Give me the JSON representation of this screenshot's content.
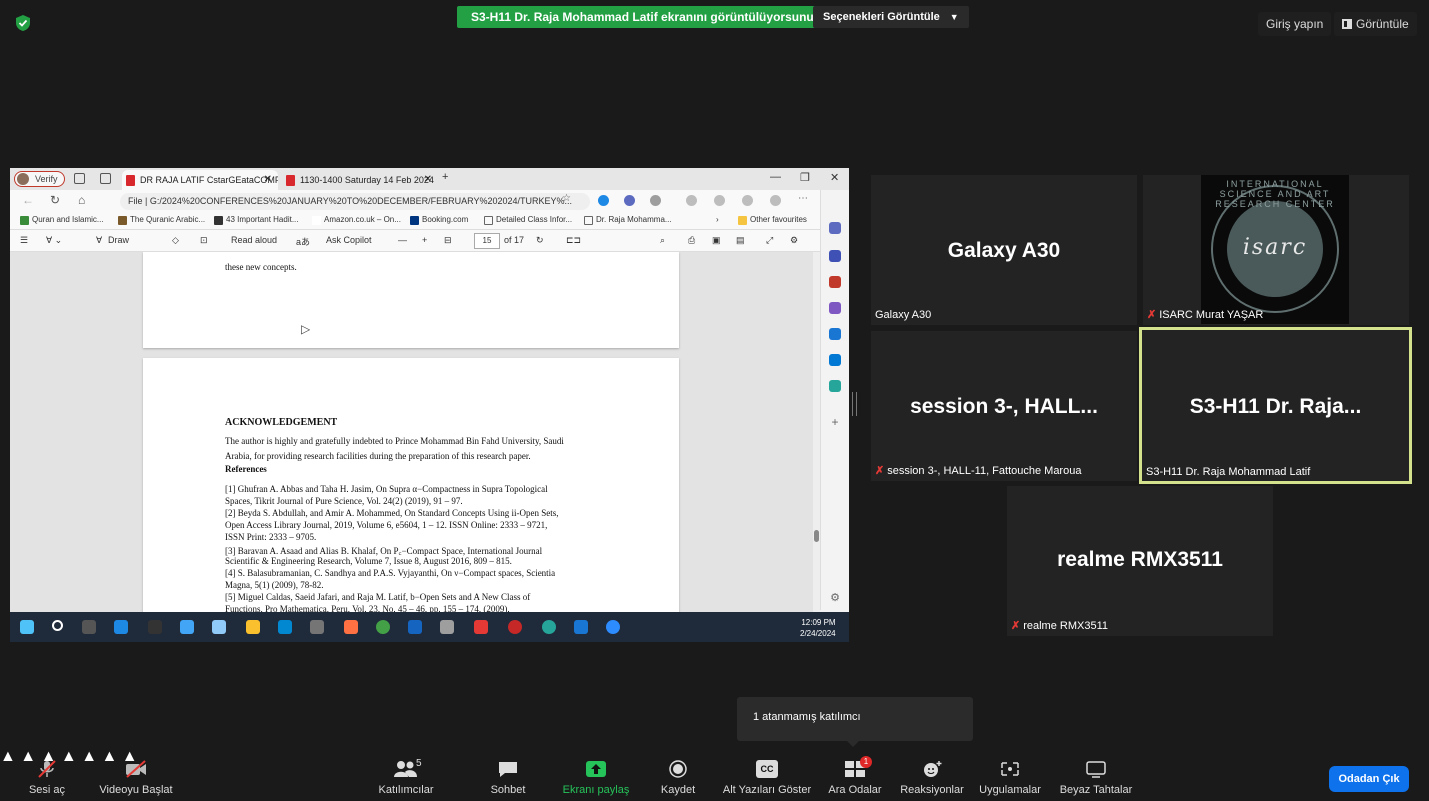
{
  "top": {
    "share_banner": "S3-H11 Dr. Raja Mohammad Latif ekranını görüntülüyorsunuz",
    "view_options": "Seçenekleri Görüntüle",
    "signin": "Giriş yapın",
    "view": "Görüntüle"
  },
  "browser": {
    "verify_label": "Verify",
    "tabs": [
      {
        "label": "DR RAJA LATIF CstarGEataCOMF"
      },
      {
        "label": "1130-1400 Saturday 14 Feb 2024"
      }
    ],
    "url": "File | G:/2024%20CONFERENCES%20JANUARY%20TO%20DECEMBER/FEBRUARY%202024/TURKEY%...",
    "favourites": [
      "Quran and Islamic...",
      "The Quranic Arabic...",
      "43 Important Hadit...",
      "Amazon.co.uk – On...",
      "Booking.com",
      "Detailed Class Infor...",
      "Dr. Raja Mohamma...",
      "Other favourites"
    ],
    "pdf_toolbar": {
      "draw": "Draw",
      "read_aloud": "Read aloud",
      "ask_copilot": "Ask Copilot",
      "page": "15",
      "of_pages": "of 17"
    },
    "page1_text": "these new concepts.",
    "page2": {
      "heading": "ACKNOWLEDGEMENT",
      "ack_line1": "The author is highly and gratefully indebted to Prince Mohammad Bin Fahd University, Saudi",
      "ack_line2": "Arabia, for providing research facilities during the preparation of this research paper.",
      "references": "References",
      "refs": [
        "[1]  Ghufran A. Abbas and Taha H. Jasim, On Supra α−Compactness in Supra Topological",
        "       Spaces, Tikrit Journal of Pure Science, Vol. 24(2) (2019), 91 – 97.",
        "[2]  Beyda S. Abdullah, and Amir A. Mohammed, On Standard Concepts Using ii-Open Sets,",
        "       Open Access Library Journal, 2019, Volume 6, e5604, 1 – 12. ISSN Online: 2333 – 9721,",
        "       ISSN Print: 2333 – 9705.",
        "[3]  Baravan A. Asaad and Alias B. Khalaf, On P꜀−Compact Space, International Journal",
        "       Scientific & Engineering Research, Volume 7, Issue 8, August 2016, 809 – 815.",
        "[4]  S. Balasubramanian, C. Sandhya and P.A.S. Vyjayanthi, On ν−Compact spaces, Scientia",
        "       Magna, 5(1) (2009), 78-82.",
        "[5]  Miguel Caldas, Saeid Jafari, and Raja M. Latif, b−Open Sets and A New Class of",
        "       Functions, Pro Mathematica, Peru, Vol. 23, No. 45 – 46, pp. 155 – 174, (2009)."
      ]
    },
    "clock_time": "12:09 PM",
    "clock_date": "2/24/2024"
  },
  "tiles": {
    "galaxy_big": "Galaxy A30",
    "galaxy_label": "Galaxy A30",
    "isarc_label": "ISARC Murat YAŞAR",
    "isarc_logo_word": "isarc",
    "isarc_logo_arc": "INTERNATIONAL SCIENCE AND ART RESEARCH CENTER",
    "session_big": "session 3-, HALL...",
    "session_label": "session 3-, HALL-11, Fattouche Maroua",
    "raja_big": "S3-H11 Dr. Raja...",
    "raja_label": "S3-H11 Dr. Raja Mohammad Latif",
    "realme_big": "realme RMX3511",
    "realme_label": "realme RMX3511"
  },
  "tooltip": "1 atanmamış katılımcı",
  "toolbar": {
    "audio": "Sesi aç",
    "video": "Videoyu Başlat",
    "participants": "Katılımcılar",
    "participants_count": "5",
    "chat": "Sohbet",
    "share": "Ekranı paylaş",
    "record": "Kaydet",
    "captions": "Alt Yazıları Göster",
    "captions_icon": "CC",
    "breakout": "Ara Odalar",
    "breakout_badge": "1",
    "reactions": "Reaksiyonlar",
    "apps": "Uygulamalar",
    "whiteboard": "Beyaz Tahtalar",
    "leave": "Odadan Çık"
  },
  "colors": {
    "banner_green": "#23a044",
    "leave_blue": "#0e72ed",
    "active_border": "#d4e28e",
    "muted_red": "#e53935"
  }
}
